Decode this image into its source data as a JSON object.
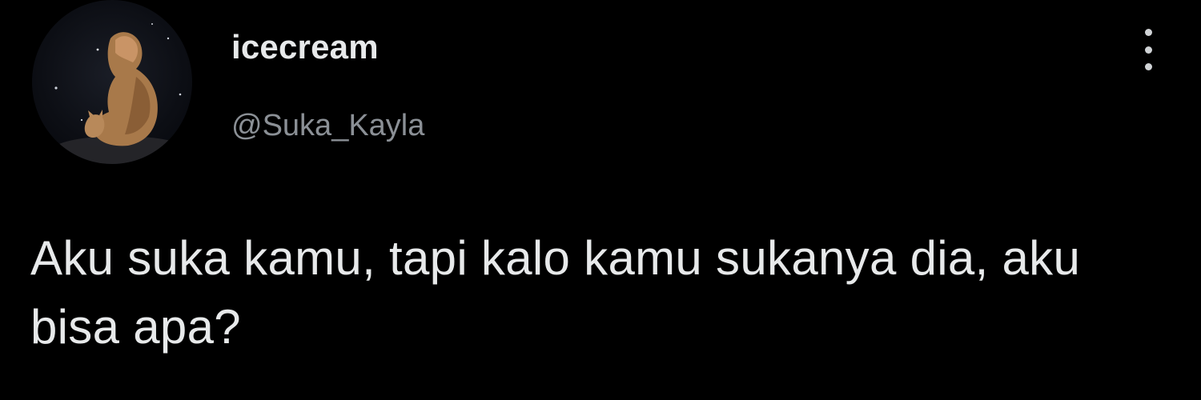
{
  "tweet": {
    "author": {
      "display_name": "icecream",
      "handle": "@Suka_Kayla",
      "avatar_icon": "profile-avatar-illustration"
    },
    "more_icon": "more-vertical-icon",
    "text": "Aku suka kamu, tapi kalo kamu sukanya dia, aku bisa apa?"
  },
  "colors": {
    "background": "#000000",
    "primary_text": "#e7e9ea",
    "secondary_text": "#8b9096"
  }
}
